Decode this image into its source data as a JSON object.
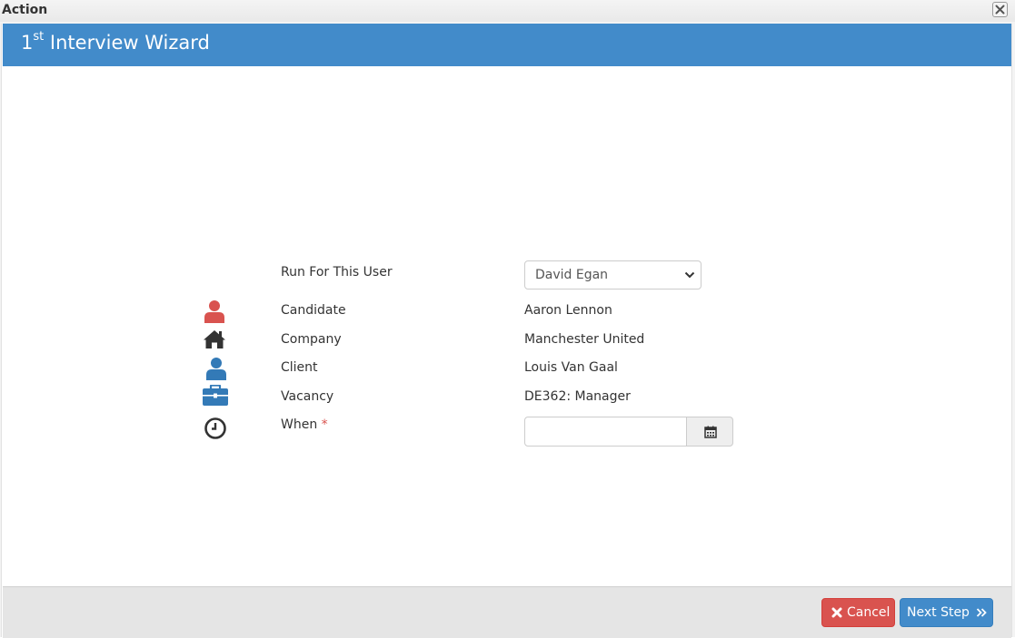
{
  "window": {
    "title": "Action"
  },
  "wizard": {
    "title_prefix": "1",
    "title_sup": "st",
    "title_rest": " Interview Wizard"
  },
  "form": {
    "run_for_user": {
      "label": "Run For This User",
      "selected": "David Egan"
    },
    "candidate": {
      "label": "Candidate",
      "value": "Aaron Lennon",
      "icon": "user-icon",
      "color": "#d9534f"
    },
    "company": {
      "label": "Company",
      "value": "Manchester United",
      "icon": "home-icon",
      "color": "#333333"
    },
    "client": {
      "label": "Client",
      "value": "Louis Van Gaal",
      "icon": "user-icon",
      "color": "#337ab7"
    },
    "vacancy": {
      "label": "Vacancy",
      "value": "DE362: Manager",
      "icon": "briefcase-icon",
      "color": "#337ab7"
    },
    "when": {
      "label": "When",
      "required_mark": "*",
      "value": "",
      "placeholder": "",
      "icon": "clock-icon"
    }
  },
  "footer": {
    "cancel_label": "Cancel",
    "next_label": "Next Step"
  },
  "colors": {
    "header": "#428bca",
    "cancel": "#d9534f",
    "next": "#428bca"
  }
}
